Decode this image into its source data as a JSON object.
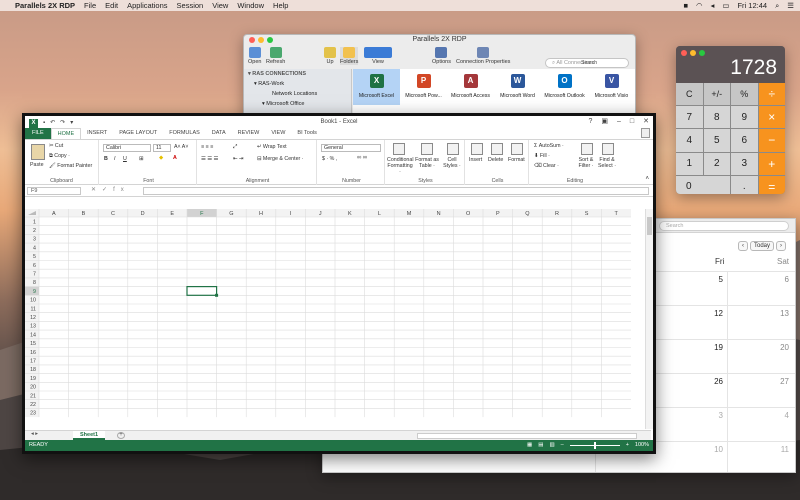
{
  "menubar": {
    "apple": "",
    "app": "Parallels 2X RDP",
    "items": [
      "File",
      "Edit",
      "Applications",
      "Session",
      "View",
      "Window",
      "Help"
    ],
    "clock": "Fri 12:44"
  },
  "parallels": {
    "title": "Parallels 2X RDP",
    "toolbar": {
      "open": "Open",
      "refresh": "Refresh",
      "up": "Up",
      "folders": "Folders",
      "view": "View",
      "options": "Options",
      "connection_properties": "Connection Properties",
      "search_placeholder": "All Connections",
      "search": "Search"
    },
    "sidebar": [
      "RAS CONNECTIONS",
      "RAS-Work",
      "Network Locations",
      "Microsoft Office"
    ],
    "apps": [
      {
        "name": "Microsoft Excel",
        "letter": "X",
        "color": "#1f7244"
      },
      {
        "name": "Microsoft Pow...",
        "letter": "P",
        "color": "#d24726"
      },
      {
        "name": "Microsoft Access",
        "letter": "A",
        "color": "#a4373a"
      },
      {
        "name": "Microsoft Word",
        "letter": "W",
        "color": "#2b579a"
      },
      {
        "name": "Microsoft Outlook",
        "letter": "O",
        "color": "#0072c6"
      },
      {
        "name": "Microsoft Visio",
        "letter": "V",
        "color": "#3955a3"
      }
    ]
  },
  "calculator": {
    "display": "1728",
    "keys": [
      "C",
      "+/-",
      "%",
      "÷",
      "7",
      "8",
      "9",
      "×",
      "4",
      "5",
      "6",
      "−",
      "1",
      "2",
      "3",
      "+",
      "0",
      ".",
      "="
    ]
  },
  "calendar": {
    "search_placeholder": "Search",
    "today": "Today",
    "prev": "‹",
    "next": "›",
    "day_headers": [
      "Fri",
      "Sat"
    ],
    "fri_dates": [
      "5",
      "12",
      "19",
      "26",
      "3",
      "10"
    ],
    "sat_dates": [
      "6",
      "13",
      "20",
      "27",
      "4",
      "11"
    ]
  },
  "excel": {
    "title": "Book1 - Excel",
    "help": "?",
    "tabs": [
      "FILE",
      "HOME",
      "INSERT",
      "PAGE LAYOUT",
      "FORMULAS",
      "DATA",
      "REVIEW",
      "VIEW",
      "BI Tools"
    ],
    "ribbon": {
      "clipboard": {
        "label": "Clipboard",
        "paste": "Paste",
        "cut": "Cut",
        "copy": "Copy ·",
        "format_painter": "Format Painter"
      },
      "font": {
        "label": "Font",
        "name": "Calibri",
        "size": "11"
      },
      "alignment": {
        "label": "Alignment",
        "wrap": "Wrap Text",
        "merge": "Merge & Center ·"
      },
      "number": {
        "label": "Number",
        "format": "General"
      },
      "styles": {
        "label": "Styles",
        "conditional": "Conditional Formatting ·",
        "format_as_table": "Format as Table ·",
        "cell_styles": "Cell Styles ·"
      },
      "cells": {
        "label": "Cells",
        "insert": "Insert",
        "delete": "Delete",
        "format": "Format"
      },
      "editing": {
        "label": "Editing",
        "autosum": "AutoSum ·",
        "fill": "Fill ·",
        "clear": "Clear ·",
        "sort": "Sort & Filter ·",
        "find": "Find & Select ·"
      }
    },
    "name_box": "F9",
    "fx": "fx",
    "columns": [
      "A",
      "B",
      "C",
      "D",
      "E",
      "F",
      "G",
      "H",
      "I",
      "J",
      "K",
      "L",
      "M",
      "N",
      "O",
      "P",
      "Q",
      "R",
      "S",
      "T"
    ],
    "rows": [
      "1",
      "2",
      "3",
      "4",
      "5",
      "6",
      "7",
      "8",
      "9",
      "10",
      "11",
      "12",
      "13",
      "14",
      "15",
      "16",
      "17",
      "18",
      "19",
      "20",
      "21",
      "22",
      "23"
    ],
    "active_col": "F",
    "active_row": "9",
    "sheet_tab": "Sheet1",
    "add_sheet": "+",
    "status": "READY",
    "zoom": "100%"
  }
}
